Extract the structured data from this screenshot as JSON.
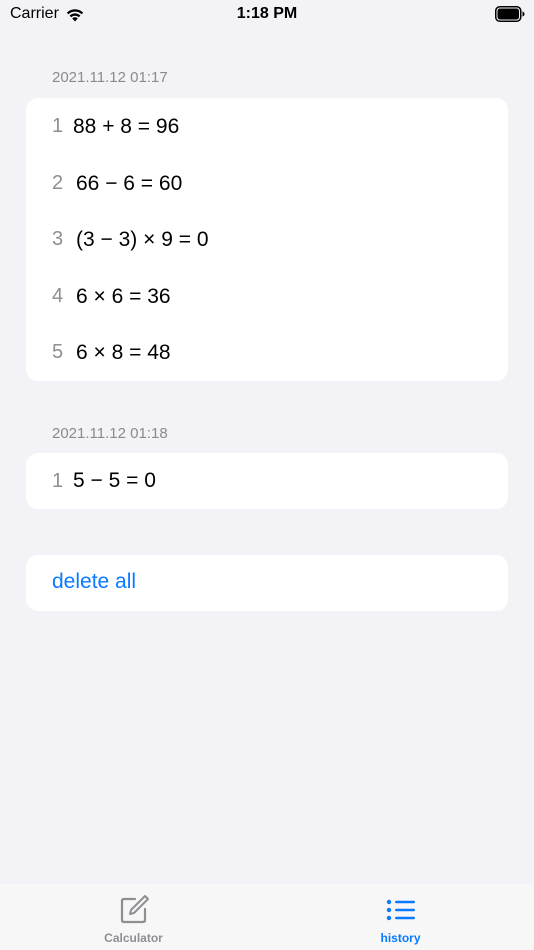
{
  "status_bar": {
    "carrier": "Carrier",
    "time": "1:18 PM"
  },
  "sessions": [
    {
      "date": "2021.11.12 01:17",
      "entries": [
        {
          "index": "1",
          "expression": "88 + 8 = 96"
        },
        {
          "index": "2",
          "expression": "66 − 6 = 60"
        },
        {
          "index": "3",
          "expression": "(3 − 3) × 9 = 0"
        },
        {
          "index": "4",
          "expression": "6 × 6 = 36"
        },
        {
          "index": "5",
          "expression": "6 × 8 = 48"
        }
      ]
    },
    {
      "date": "2021.11.12 01:18",
      "entries": [
        {
          "index": "1",
          "expression": "5 − 5 = 0"
        }
      ]
    }
  ],
  "actions": {
    "delete_all": "delete all"
  },
  "tab_bar": {
    "tabs": [
      {
        "label": "Calculator",
        "icon": "edit-icon",
        "selected": false
      },
      {
        "label": "history",
        "icon": "list-icon",
        "selected": true
      }
    ]
  },
  "colors": {
    "accent": "#0a7aff",
    "background": "#f2f2f7",
    "secondary_text": "#8a8a8e",
    "inactive_tab": "#8e8e93"
  }
}
